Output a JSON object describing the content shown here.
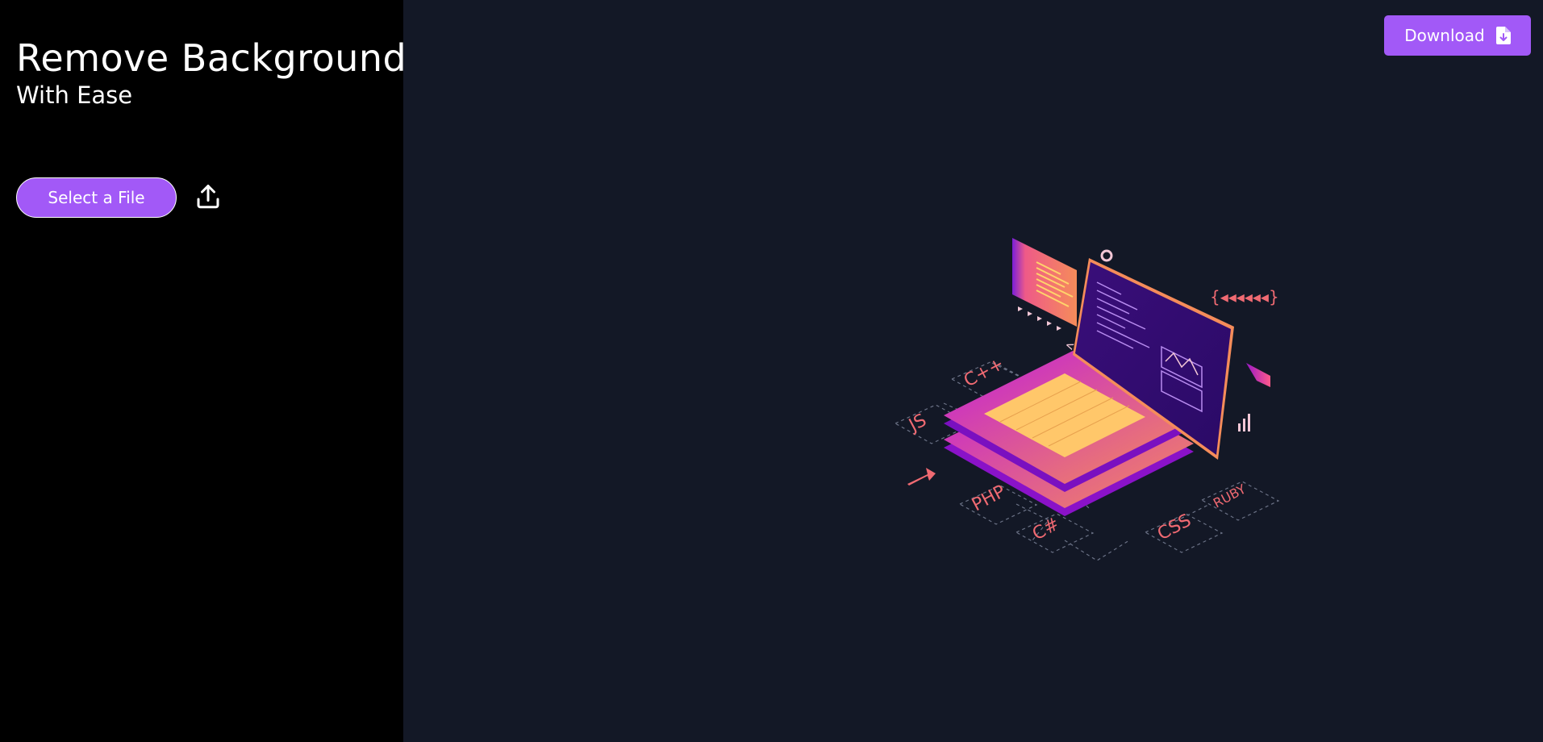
{
  "sidebar": {
    "title": "Remove Background",
    "subtitle": "With Ease",
    "select_button_label": "Select a File",
    "upload_icon": "upload-icon"
  },
  "header": {
    "download_label": "Download",
    "download_icon": "file-download-icon"
  },
  "illustration": {
    "labels": [
      "C++",
      "JS",
      "PHP",
      "C#",
      "CSS",
      "RUBY"
    ],
    "colors": {
      "accent": "#a259f7",
      "sidebar_bg": "#000000",
      "main_bg": "#131826",
      "magenta": "#c21fd8",
      "orange": "#f58c5a",
      "label": "#f06a72"
    }
  }
}
